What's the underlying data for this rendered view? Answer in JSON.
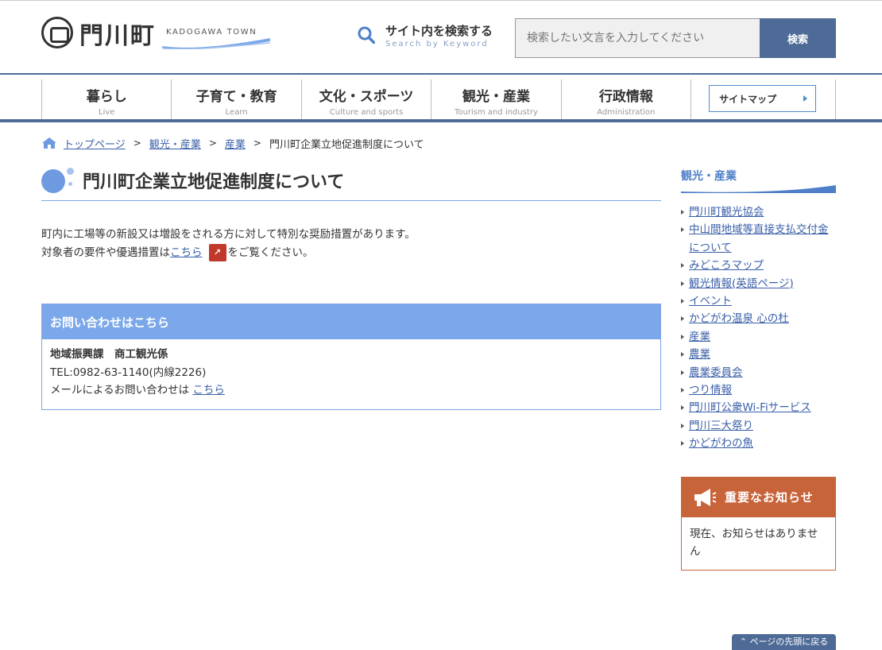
{
  "header": {
    "logo_name": "門川町",
    "logo_sub": "KADOGAWA TOWN",
    "search_title": "サイト内を検索する",
    "search_sub": "Search by Keyword",
    "search_placeholder": "検索したい文言を入力してください",
    "search_button": "検索"
  },
  "nav": {
    "items": [
      {
        "jp": "暮らし",
        "en": "Live"
      },
      {
        "jp": "子育て・教育",
        "en": "Learn"
      },
      {
        "jp": "文化・スポーツ",
        "en": "Culture and sports"
      },
      {
        "jp": "観光・産業",
        "en": "Tourism and industry"
      },
      {
        "jp": "行政情報",
        "en": "Administration"
      }
    ],
    "sitemap": "サイトマップ"
  },
  "breadcrumb": {
    "items": [
      "トップページ",
      "観光・産業",
      "産業"
    ],
    "current": "門川町企業立地促進制度について"
  },
  "main": {
    "title": "門川町企業立地促進制度について",
    "line1": "町内に工場等の新設又は増設をされる方に対して特別な奨励措置があります。",
    "line2_pre": "対象者の要件や優遇措置は",
    "line2_link": "こちら",
    "line2_post": "をご覧ください。",
    "pdf_icon": "pdf-icon"
  },
  "contact": {
    "heading": "お問い合わせはこちら",
    "dept": "地域振興課　商工観光係",
    "tel": "TEL:0982-63-1140(内線2226)",
    "mail_pre": "メールによるお問い合わせは ",
    "mail_link": "こちら"
  },
  "sidebar": {
    "title": "観光・産業",
    "links": [
      "門川町観光協会",
      "中山間地域等直接支払交付金について",
      "みどころマップ",
      "観光情報(英語ページ)",
      "イベント",
      "かどがわ温泉 心の杜",
      "産業",
      "農業",
      "農業委員会",
      "つり情報",
      "門川町公衆Wi-Fiサービス",
      "門川三大祭り",
      "かどがわの魚"
    ],
    "notice_heading": "重要なお知らせ",
    "notice_body": "現在、お知らせはありません"
  },
  "pagetop": "ページの先頭に戻る",
  "colors": {
    "accent": "#4e6b97",
    "light_blue": "#7ba8ea",
    "notice": "#c8643a"
  }
}
